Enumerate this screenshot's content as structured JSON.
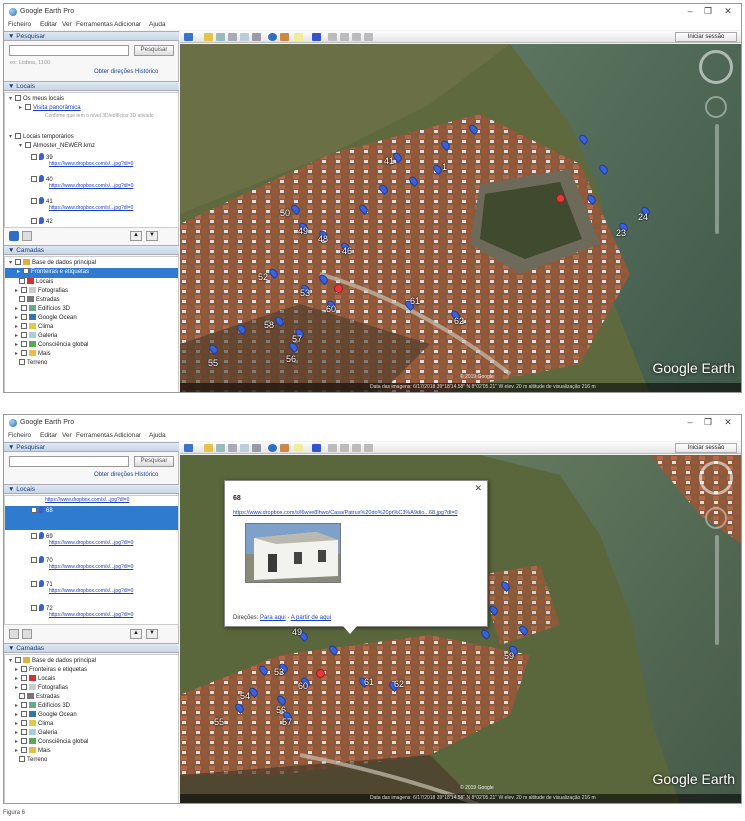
{
  "app": {
    "title": "Google Earth Pro",
    "sign_in": "Iniciar sessão",
    "logo": "Google Earth"
  },
  "menu": [
    "Ficheiro",
    "Editar",
    "Ver",
    "Ferramentas",
    "Adicionar",
    "Ajuda"
  ],
  "search": {
    "header": "▼ Pesquisar",
    "button": "Pesquisar",
    "example": "ex: Lisboa, 1100",
    "links": "Obter direções  Histórico"
  },
  "places": {
    "header": "▼ Locais",
    "mine": "Os meus locais",
    "tour": "Visita panorâmica",
    "tour_note": "Confirme que tem o nível 3D/edifícios 3D ativado",
    "temp": "Locais temporários",
    "file": "Almoster_NEWER.kmz"
  },
  "layers": {
    "header": "▼ Camadas",
    "items": [
      "Base de dados principal",
      "Fronteiras e etiquetas",
      "Locais",
      "Fotografias",
      "Estradas",
      "Edifícios 3D",
      "Google Ocean",
      "Clima",
      "Galeria",
      "Consciência global",
      "Mais",
      "Terreno"
    ]
  },
  "top_pins": [
    {
      "label": "41"
    },
    {
      "label": "50"
    },
    {
      "label": "49"
    },
    {
      "label": "48"
    },
    {
      "label": "46"
    },
    {
      "label": "52"
    },
    {
      "label": "53"
    },
    {
      "label": "58"
    },
    {
      "label": "60"
    },
    {
      "label": "61"
    },
    {
      "label": "62"
    },
    {
      "label": "55"
    },
    {
      "label": "56"
    },
    {
      "label": "57"
    },
    {
      "label": "23"
    },
    {
      "label": "24"
    },
    {
      "label": "1"
    }
  ],
  "bottom_pins": [
    {
      "label": "55"
    },
    {
      "label": "54"
    },
    {
      "label": "56"
    },
    {
      "label": "57"
    },
    {
      "label": "61"
    },
    {
      "label": "62"
    },
    {
      "label": "49"
    },
    {
      "label": "53"
    },
    {
      "label": "60"
    },
    {
      "label": "59"
    }
  ],
  "popup": {
    "title": "68",
    "url": "https://www.dropbox.com/s/l6wve8lhwo/Casa/Patrus%20do%20pr%C3%A9dio...68.jpg?dl=0",
    "dirs_label": "Direções:",
    "dir_to": "Para aqui",
    "dir_sep": " - ",
    "dir_from": "A partir de aqui"
  },
  "status": "Data das imagens: 6/17/2018   39°18'14.58\" N   8°02'05.21\" W   elev.   20 m     altitude de visualização  216 m",
  "copyright": "© 2019 Google",
  "caption": "Figura 6"
}
